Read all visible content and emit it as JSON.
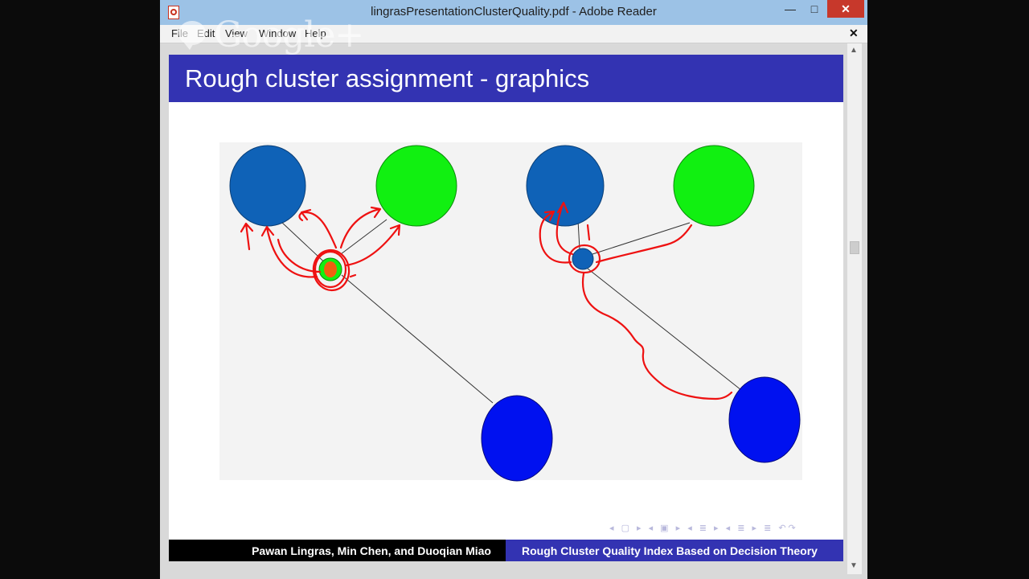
{
  "window": {
    "title": "lingrasPresentationClusterQuality.pdf - Adobe Reader",
    "minimize_glyph": "—",
    "maximize_glyph": "□",
    "close_glyph": "✕"
  },
  "menu": {
    "items": [
      "File",
      "Edit",
      "View",
      "Window",
      "Help"
    ],
    "close_doc_glyph": "✕"
  },
  "overlay": {
    "brand_text": "Google+"
  },
  "slide": {
    "title": "Rough cluster assignment - graphics",
    "nav_glyphs": "◂ ▢ ▸ ◂ ▣ ▸ ◂ ≣ ▸ ◂ ≣ ▸ ≣ ↶↷",
    "footer_authors": "Pawan Lingras, Min Chen, and Duoqian Miao",
    "footer_title": "Rough Cluster Quality Index Based on Decision Theory"
  },
  "figure": {
    "colors": {
      "cluster_blue_dark": "#0f62b7",
      "cluster_green": "#11f011",
      "cluster_blue": "#0011f0",
      "annotation_red": "#ee1111",
      "object_orange": "#f06010"
    }
  },
  "scrollbar": {
    "up_glyph": "▲",
    "down_glyph": "▼"
  }
}
